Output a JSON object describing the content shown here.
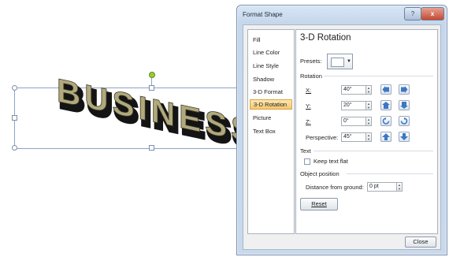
{
  "slide": {
    "wordart_text": "BUSINESS",
    "wordart_face_color": "#b1a97c",
    "wordart_side_color": "#1a1a1a"
  },
  "dialog": {
    "title": "Format Shape",
    "help_icon": "help-icon",
    "close_label": "x",
    "nav_items": [
      "Fill",
      "Line Color",
      "Line Style",
      "Shadow",
      "3-D Format",
      "3-D Rotation",
      "Picture",
      "Text Box"
    ],
    "selected_nav": "3-D Rotation",
    "panel_title": "3-D Rotation",
    "presets_label": "Presets:",
    "rotation_section": "Rotation",
    "x_label": "X:",
    "x_value": "40°",
    "y_label": "Y:",
    "y_value": "20°",
    "z_label": "Z:",
    "z_value": "0°",
    "perspective_label": "Perspective:",
    "perspective_value": "45°",
    "text_section": "Text",
    "keep_text_flat_label": "Keep text flat",
    "keep_text_flat_checked": false,
    "object_position_section": "Object position",
    "distance_label": "Distance from ground:",
    "distance_value": "0 pt",
    "reset_label": "Reset",
    "close_button_label": "Close"
  }
}
